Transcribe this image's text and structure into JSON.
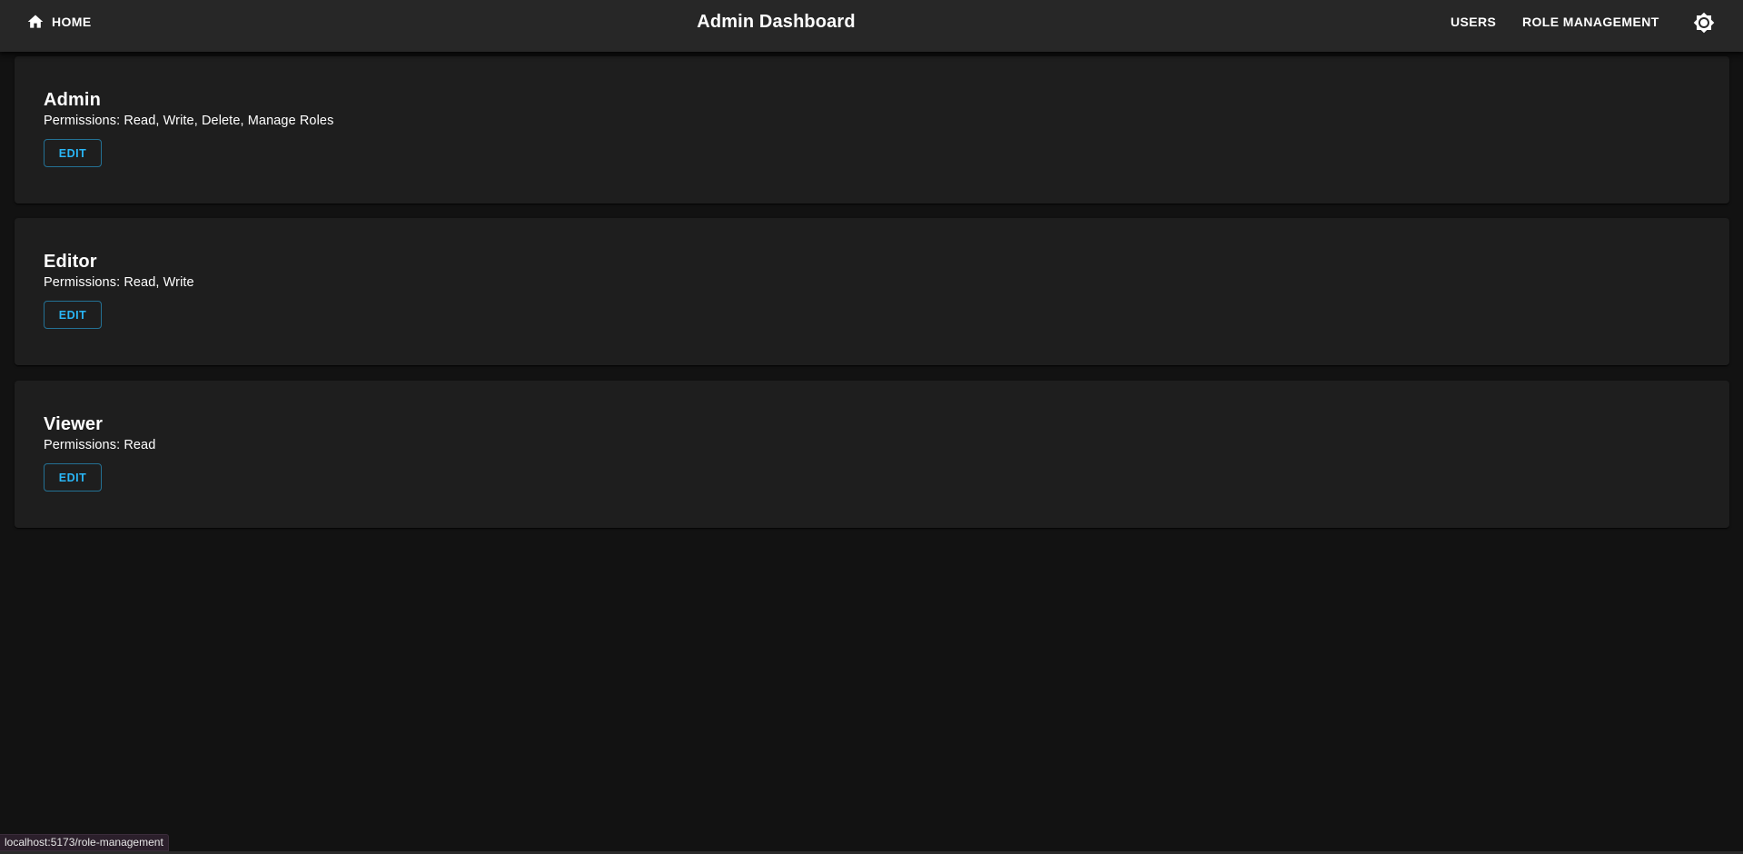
{
  "header": {
    "home_label": "HOME",
    "home_icon": "home-icon",
    "title": "Admin Dashboard",
    "nav_items": [
      {
        "label": "USERS"
      },
      {
        "label": "ROLE MANAGEMENT"
      }
    ],
    "theme_icon": "brightness-icon"
  },
  "roles": [
    {
      "name": "Admin",
      "permissions": "Permissions: Read, Write, Delete, Manage Roles",
      "edit_label": "EDIT"
    },
    {
      "name": "Editor",
      "permissions": "Permissions: Read, Write",
      "edit_label": "EDIT"
    },
    {
      "name": "Viewer",
      "permissions": "Permissions: Read",
      "edit_label": "EDIT"
    }
  ],
  "status_bar": {
    "url": "localhost:5173/role-management"
  },
  "colors": {
    "background": "#121212",
    "appbar": "#272727",
    "card": "#1e1e1e",
    "accent": "#29b6f6",
    "text": "#ffffff"
  }
}
